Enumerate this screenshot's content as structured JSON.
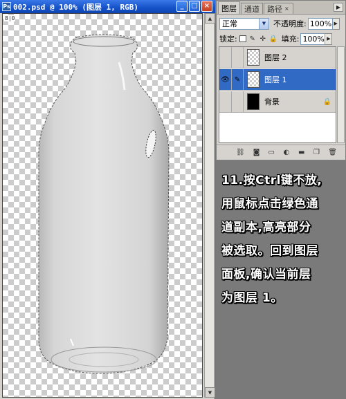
{
  "document": {
    "title": "002.psd @ 100% (图层 1, RGB)",
    "ps_icon": "Ps",
    "origin_mark": "8|0",
    "buttons": {
      "minimize": "_",
      "maximize": "□",
      "close": "×"
    }
  },
  "panel": {
    "tabs": [
      {
        "label": "图层",
        "active": true
      },
      {
        "label": "通道",
        "active": false
      },
      {
        "label": "路径",
        "active": false
      }
    ],
    "blend_mode": "正常",
    "opacity_label": "不透明度:",
    "opacity_value": "100%",
    "lock_label": "锁定:",
    "fill_label": "填充:",
    "fill_value": "100%",
    "layers": [
      {
        "name": "图层 2",
        "visible": false,
        "selected": false,
        "thumb": "transparent"
      },
      {
        "name": "图层 1",
        "visible": true,
        "selected": true,
        "thumb": "transparent"
      },
      {
        "name": "背景",
        "visible": false,
        "selected": false,
        "thumb": "black",
        "locked": true
      }
    ]
  },
  "instructions": {
    "lines": [
      "11.按Ctrl键不放,",
      "用鼠标点击绿色通",
      "道副本,高亮部分",
      "被选取。回到图层",
      "面板,确认当前层",
      "为图层 1。"
    ]
  },
  "colors": {
    "titlebar": "#1552c8",
    "selection": "#316ac5",
    "background": "#7a7a7a"
  }
}
